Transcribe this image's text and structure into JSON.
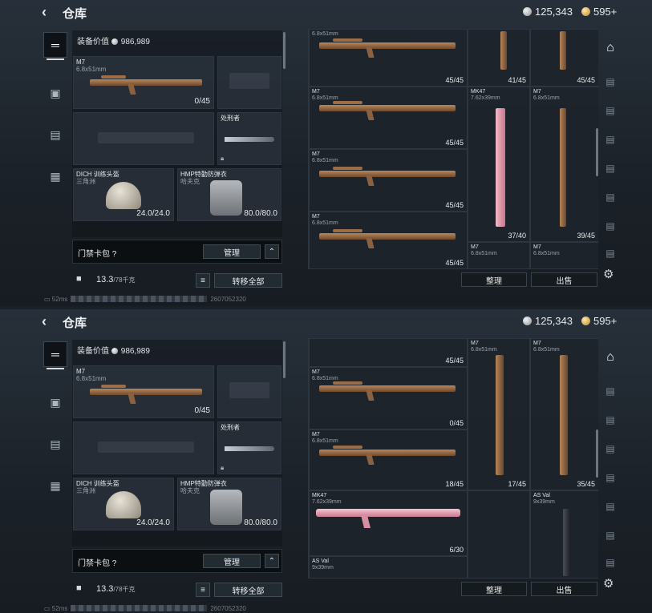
{
  "screens": [
    {
      "header": {
        "back_icon": "arrow-left-icon",
        "title": "仓库",
        "silver": "125,343",
        "gold": "595+"
      },
      "equipment": {
        "value_label": "装备价值",
        "value": "986,989",
        "primary": {
          "name": "M7",
          "caliber": "6.8x51mm",
          "ammo": "0/45"
        },
        "melee_label": "处刑者",
        "helmet": {
          "name": "DICH 训练头盔",
          "sub": "三角洲",
          "durability": "24.0/24.0"
        },
        "armor": {
          "name": "HMP特勤防弹衣",
          "sub": "哈夫克",
          "durability": "80.0/80.0"
        },
        "card_label": "门禁卡包",
        "card_help": "?",
        "manage": "管理",
        "weight": "13.3",
        "weight_max": "/78千克",
        "transfer_all": "转移全部"
      },
      "grid": {
        "cells": [
          {
            "name": "",
            "caliber": "6.8x51mm",
            "count": "45/45"
          },
          {
            "name": "",
            "caliber": "",
            "count": "41/45"
          },
          {
            "name": "",
            "caliber": "",
            "count": "45/45"
          },
          {
            "name": "M7",
            "caliber": "6.8x51mm",
            "count": "45/45"
          },
          {
            "name": "MK47",
            "caliber": "7.62x39mm",
            "count": "37/40"
          },
          {
            "name": "M7",
            "caliber": "6.8x51mm",
            "count": "39/45"
          },
          {
            "name": "M7",
            "caliber": "6.8x51mm",
            "count": "45/45"
          },
          {
            "name": "M7",
            "caliber": "6.8x51mm",
            "count": "45/45"
          },
          {
            "name": "M7",
            "caliber": "6.8x51mm",
            "count": ""
          },
          {
            "name": "M7",
            "caliber": "6.8x51mm",
            "count": ""
          }
        ],
        "sort": "整理",
        "sell": "出售"
      },
      "status": {
        "ping": "52ms",
        "code": "2607052320"
      }
    },
    {
      "header": {
        "back_icon": "arrow-left-icon",
        "title": "仓库",
        "silver": "125,343",
        "gold": "595+"
      },
      "equipment": {
        "value_label": "装备价值",
        "value": "986,989",
        "primary": {
          "name": "M7",
          "caliber": "6.8x51mm",
          "ammo": "0/45"
        },
        "melee_label": "处刑者",
        "helmet": {
          "name": "DICH 训练头盔",
          "sub": "三角洲",
          "durability": "24.0/24.0"
        },
        "armor": {
          "name": "HMP特勤防弹衣",
          "sub": "哈夫克",
          "durability": "80.0/80.0"
        },
        "card_label": "门禁卡包",
        "card_help": "?",
        "manage": "管理",
        "weight": "13.3",
        "weight_max": "/78千克",
        "transfer_all": "转移全部"
      },
      "grid": {
        "cells": [
          {
            "name": "",
            "caliber": "",
            "count": "45/45"
          },
          {
            "name": "M7",
            "caliber": "6.8x51mm",
            "count": ""
          },
          {
            "name": "M7",
            "caliber": "6.8x51mm",
            "count": ""
          },
          {
            "name": "M7",
            "caliber": "6.8x51mm",
            "count": "0/45"
          },
          {
            "name": "",
            "caliber": "",
            "count": "17/45"
          },
          {
            "name": "",
            "caliber": "",
            "count": "35/45"
          },
          {
            "name": "M7",
            "caliber": "6.8x51mm",
            "count": "18/45"
          },
          {
            "name": "MK47",
            "caliber": "7.62x39mm",
            "count": "6/30"
          },
          {
            "name": "AS Val",
            "caliber": "9x39mm",
            "count": ""
          },
          {
            "name": "AS Val",
            "caliber": "9x39mm",
            "count": ""
          }
        ],
        "sort": "整理",
        "sell": "出售"
      },
      "status": {
        "ping": "52ms",
        "code": "2607052320"
      }
    }
  ]
}
